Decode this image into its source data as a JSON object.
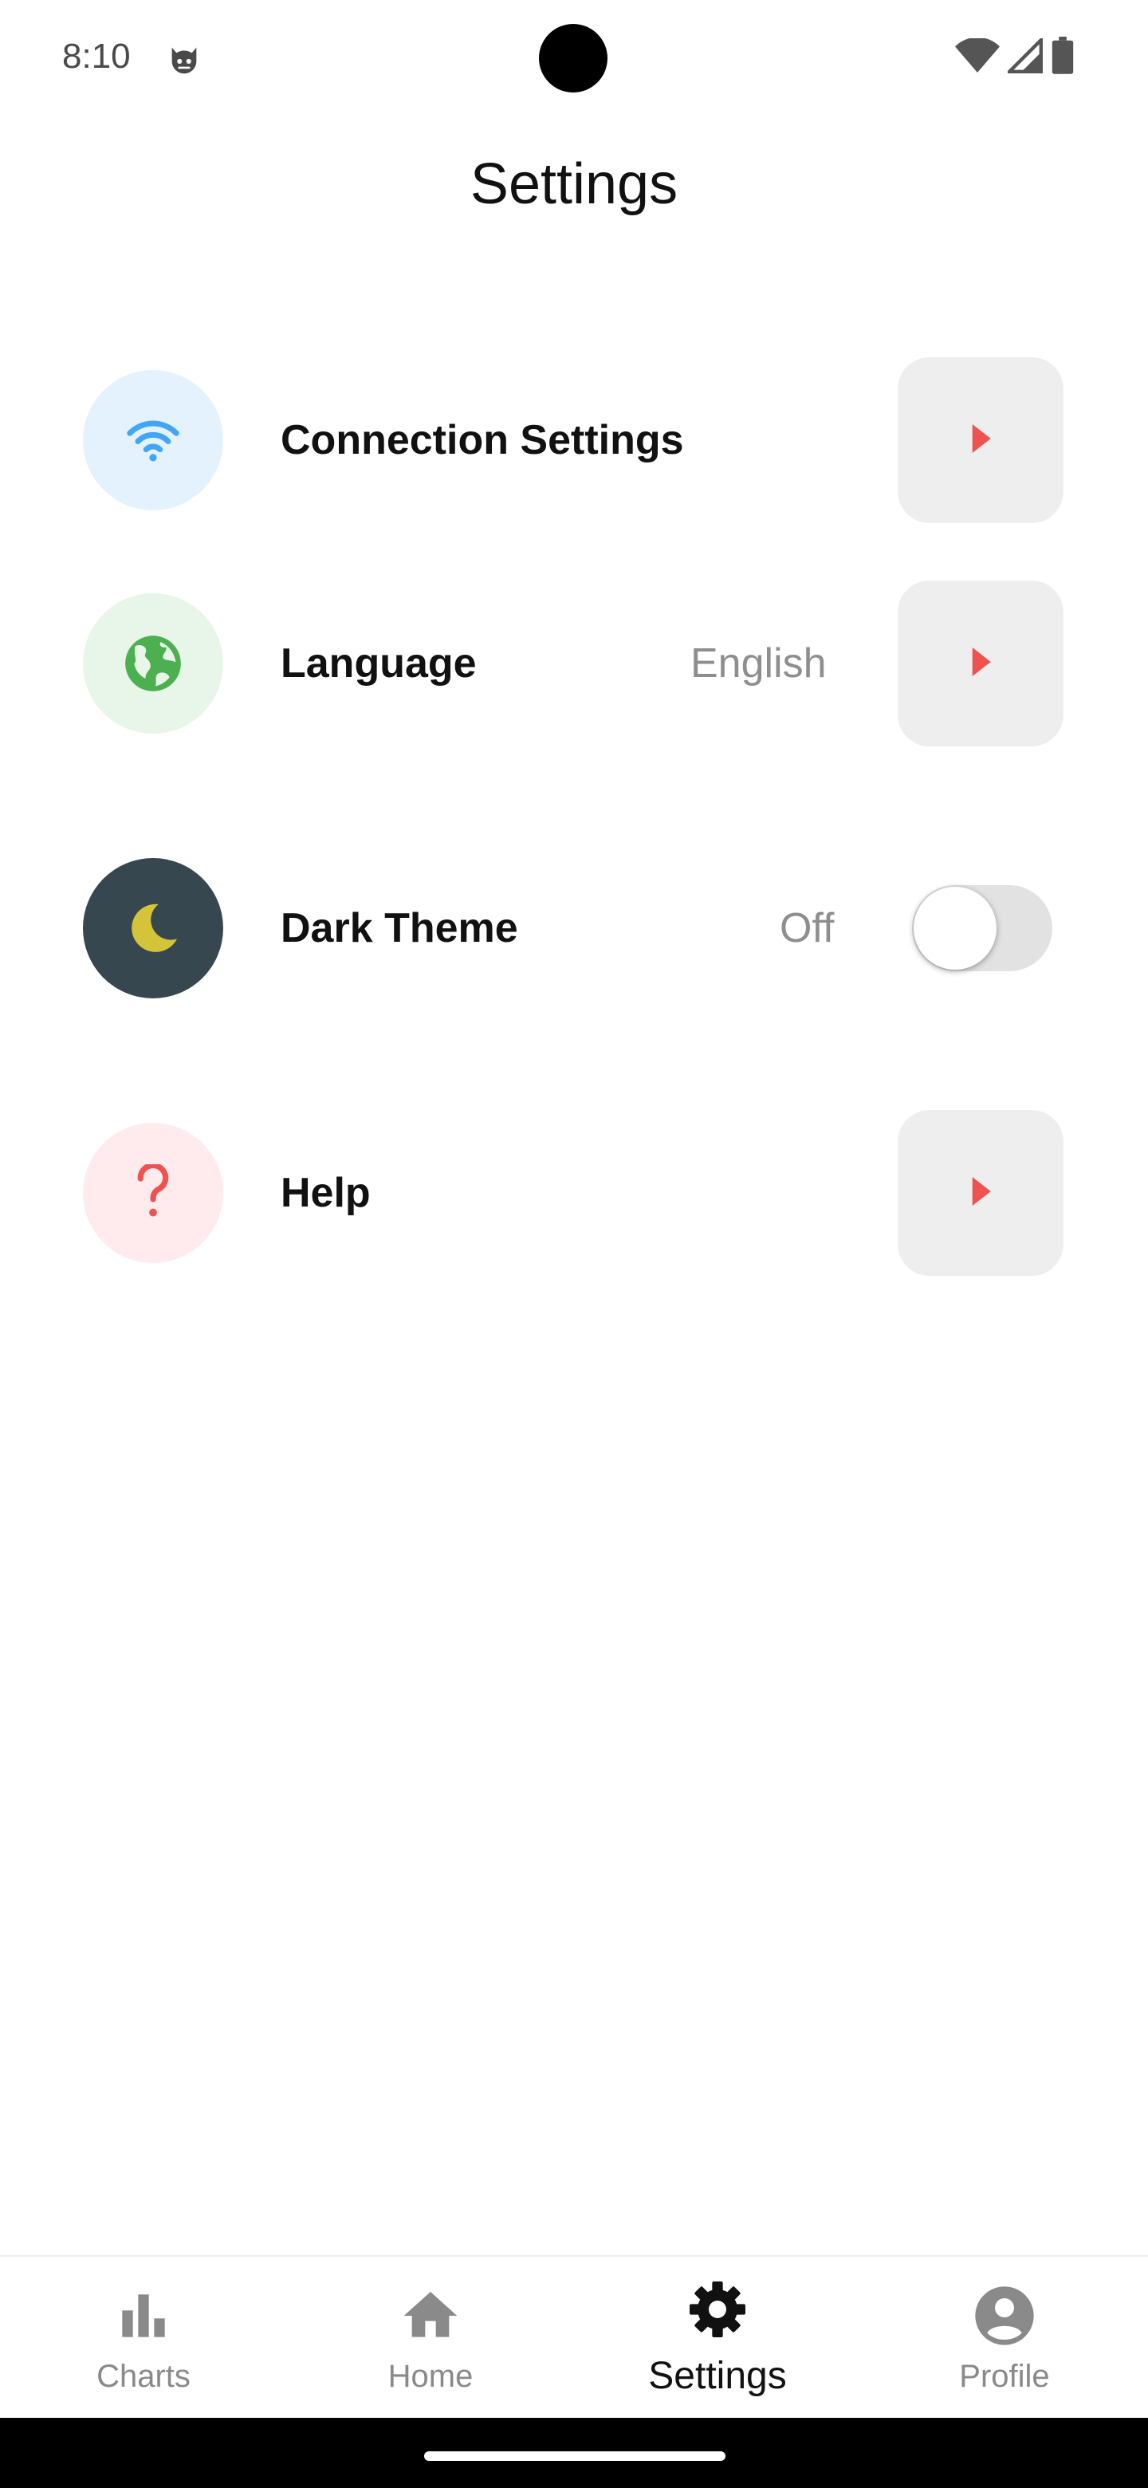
{
  "status_bar": {
    "time": "8:10",
    "app_icon": "cat-face-icon",
    "right_icons": [
      "wifi-icon",
      "cellular-signal-icon",
      "battery-icon"
    ]
  },
  "header": {
    "title": "Settings"
  },
  "settings": [
    {
      "label": "Connection Settings",
      "icon": "wifi-icon",
      "icon_color": "#42a5f5",
      "icon_bg": "#e3f2fd",
      "action": "chevron"
    },
    {
      "label": "Language",
      "value": "English",
      "icon": "globe-icon",
      "icon_color": "#4caf50",
      "icon_bg": "#e8f5e9",
      "action": "chevron"
    },
    {
      "label": "Dark Theme",
      "value": "Off",
      "icon": "moon-icon",
      "icon_color": "#d4c43a",
      "icon_bg": "#37474f",
      "action": "toggle",
      "toggle_on": false
    },
    {
      "label": "Help",
      "icon": "question-mark-icon",
      "icon_color": "#ef5350",
      "icon_bg": "#ffebee",
      "action": "chevron"
    }
  ],
  "colors": {
    "chevron": "#ef5350",
    "chevron_button_bg": "#eeeeee",
    "nav_active": "#111111",
    "nav_inactive": "#8a8a8a"
  },
  "bottom_nav": {
    "items": [
      {
        "label": "Charts",
        "icon": "bar-chart-icon",
        "active": false
      },
      {
        "label": "Home",
        "icon": "home-icon",
        "active": false
      },
      {
        "label": "Settings",
        "icon": "gear-icon",
        "active": true
      },
      {
        "label": "Profile",
        "icon": "account-circle-icon",
        "active": false
      }
    ]
  }
}
